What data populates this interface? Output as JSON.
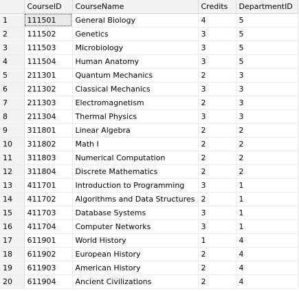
{
  "grid": {
    "columns": [
      "CourseID",
      "CourseName",
      "Credits",
      "DepartmentID"
    ],
    "rows": [
      {
        "num": "1",
        "CourseID": "111501",
        "CourseName": "General Biology",
        "Credits": "4",
        "DepartmentID": "5"
      },
      {
        "num": "2",
        "CourseID": "111502",
        "CourseName": "Genetics",
        "Credits": "3",
        "DepartmentID": "5"
      },
      {
        "num": "3",
        "CourseID": "111503",
        "CourseName": "Microbiology",
        "Credits": "3",
        "DepartmentID": "5"
      },
      {
        "num": "4",
        "CourseID": "111504",
        "CourseName": "Human Anatomy",
        "Credits": "3",
        "DepartmentID": "5"
      },
      {
        "num": "5",
        "CourseID": "211301",
        "CourseName": "Quantum Mechanics",
        "Credits": "2",
        "DepartmentID": "3"
      },
      {
        "num": "6",
        "CourseID": "211302",
        "CourseName": "Classical Mechanics",
        "Credits": "3",
        "DepartmentID": "3"
      },
      {
        "num": "7",
        "CourseID": "211303",
        "CourseName": "Electromagnetism",
        "Credits": "2",
        "DepartmentID": "3"
      },
      {
        "num": "8",
        "CourseID": "211304",
        "CourseName": "Thermal Physics",
        "Credits": "3",
        "DepartmentID": "3"
      },
      {
        "num": "9",
        "CourseID": "311801",
        "CourseName": "Linear Algebra",
        "Credits": "2",
        "DepartmentID": "2"
      },
      {
        "num": "10",
        "CourseID": "311802",
        "CourseName": "Math I",
        "Credits": "2",
        "DepartmentID": "2"
      },
      {
        "num": "11",
        "CourseID": "311803",
        "CourseName": "Numerical Computation",
        "Credits": "2",
        "DepartmentID": "2"
      },
      {
        "num": "12",
        "CourseID": "311804",
        "CourseName": "Discrete Mathematics",
        "Credits": "2",
        "DepartmentID": "2"
      },
      {
        "num": "13",
        "CourseID": "411701",
        "CourseName": "Introduction to Programming",
        "Credits": "3",
        "DepartmentID": "1"
      },
      {
        "num": "14",
        "CourseID": "411702",
        "CourseName": "Algorithms and Data Structures",
        "Credits": "2",
        "DepartmentID": "1"
      },
      {
        "num": "15",
        "CourseID": "411703",
        "CourseName": "Database Systems",
        "Credits": "3",
        "DepartmentID": "1"
      },
      {
        "num": "16",
        "CourseID": "411704",
        "CourseName": "Computer Networks",
        "Credits": "3",
        "DepartmentID": "1"
      },
      {
        "num": "17",
        "CourseID": "611901",
        "CourseName": "World History",
        "Credits": "1",
        "DepartmentID": "4"
      },
      {
        "num": "18",
        "CourseID": "611902",
        "CourseName": "European History",
        "Credits": "2",
        "DepartmentID": "4"
      },
      {
        "num": "19",
        "CourseID": "611903",
        "CourseName": "American History",
        "Credits": "2",
        "DepartmentID": "4"
      },
      {
        "num": "20",
        "CourseID": "611904",
        "CourseName": "Ancient Civilizations",
        "Credits": "2",
        "DepartmentID": "4"
      }
    ],
    "selected_cell": {
      "row": 0,
      "column": "CourseID"
    }
  }
}
